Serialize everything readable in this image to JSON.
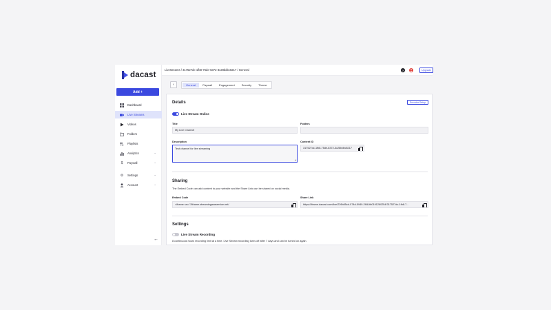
{
  "app": {
    "logo_text": "dacast",
    "add_button": "Add +"
  },
  "sidebar": {
    "items": [
      {
        "label": "Dashboard",
        "icon": "grid-icon"
      },
      {
        "label": "Live Streams",
        "icon": "video-camera-icon",
        "active": true
      },
      {
        "label": "Videos",
        "icon": "play-icon"
      },
      {
        "label": "Folders",
        "icon": "folder-icon"
      },
      {
        "label": "Playlists",
        "icon": "playlist-icon"
      },
      {
        "label": "Analytics",
        "icon": "bar-chart-icon"
      },
      {
        "label": "Paywall",
        "icon": "dollar-icon"
      },
      {
        "label": "Settings",
        "icon": "gear-icon"
      },
      {
        "label": "Account",
        "icon": "user-icon"
      }
    ],
    "collapse_glyph": "←"
  },
  "topbar": {
    "breadcrumb": "Livestreams  /  317527dc-1fb8-75de-6372-3c28bdbc8217  /  General",
    "help_glyph": "?",
    "upgrade_label": "Upgrade"
  },
  "tabs": {
    "back_glyph": "‹",
    "items": [
      "General",
      "Paywall",
      "Engagement",
      "Security",
      "Theme"
    ],
    "active": "General"
  },
  "details": {
    "title": "Details",
    "encoder_setup": "Encoder Setup",
    "live_toggle_label": "Live Stream Online",
    "title_label": "Title",
    "title_value": "My Live Channel",
    "folders_label": "Folders",
    "folders_value": "",
    "description_label": "Description",
    "description_value": "Test channel for live streaming",
    "content_id_label": "Content ID",
    "content_id_value": "317527dc-1fb8-75de-6372-3c28bdbc8217"
  },
  "sharing": {
    "title": "Sharing",
    "description": "The Embed Code can add content to your website and the Share Link can be shared on social media.",
    "embed_label": "Embed Code",
    "embed_value": "<iframe src=\"//iframe.streamingasaservice.net/",
    "share_label": "Share Link",
    "share_value": "https://iframe.dacast.com/live/226b85cd-074d-5949-2f48-fb0191260254/317527dc-1fb8-7..."
  },
  "settings": {
    "title": "Settings",
    "recording_label": "Live Stream Recording",
    "recording_note": "8 continuous hours recording limit at a time. Live Stream recording turns off after 7 days and can be turned on again."
  }
}
